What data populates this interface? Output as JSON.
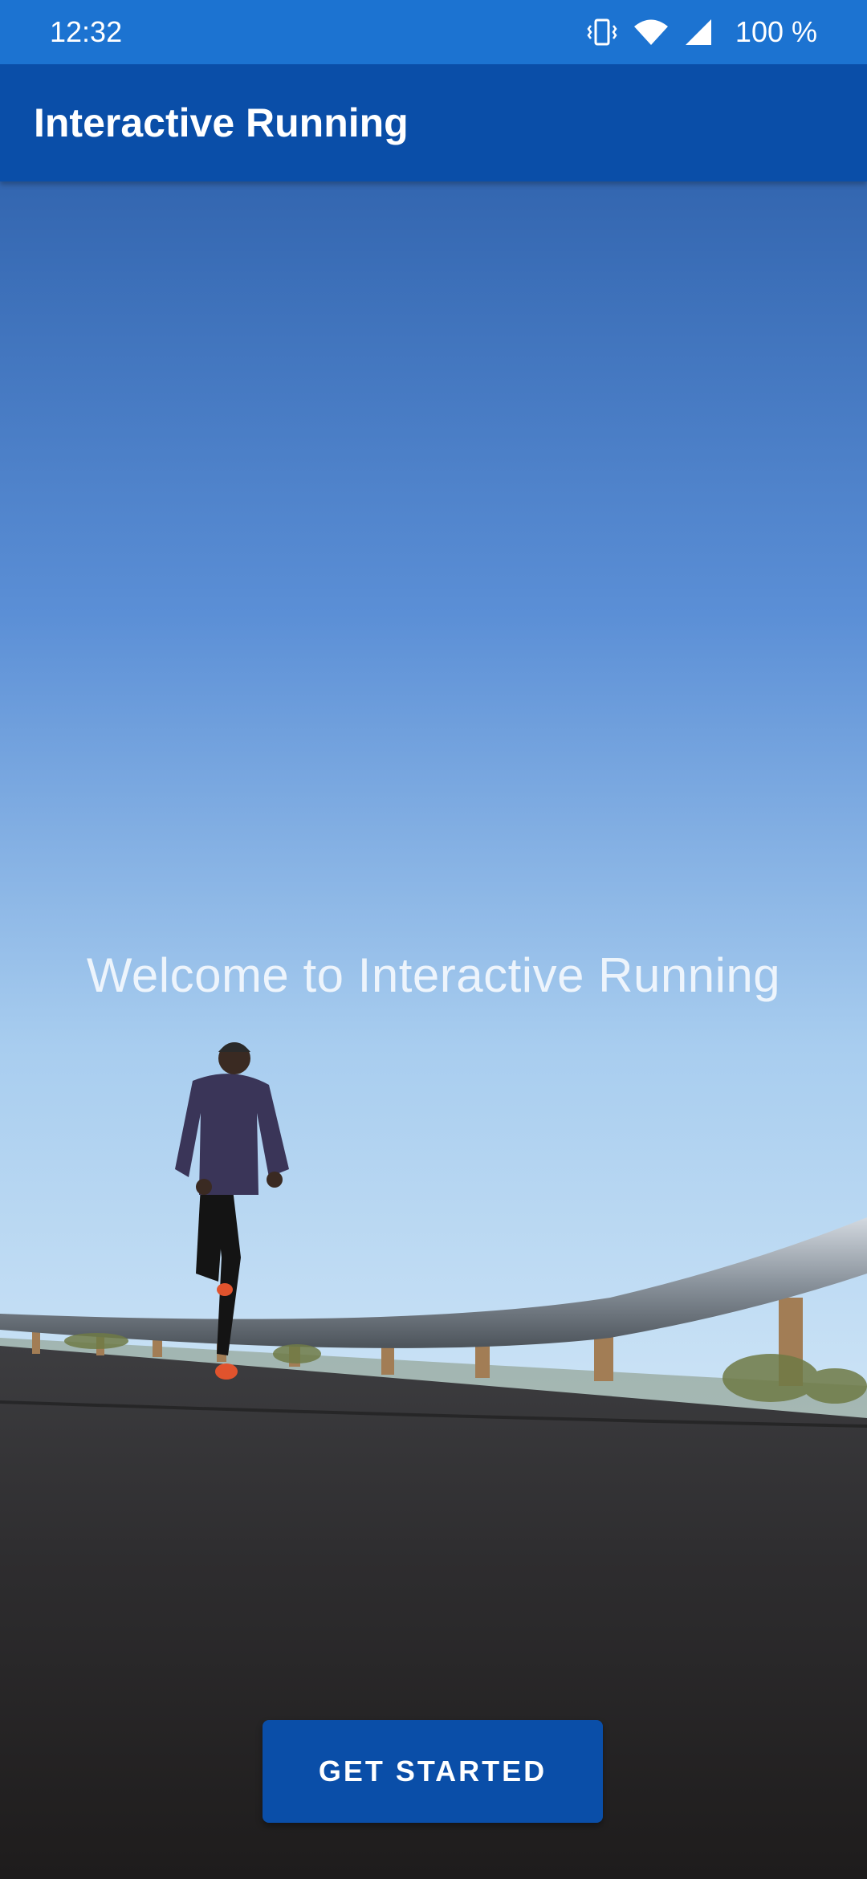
{
  "status_bar": {
    "time": "12:32",
    "battery": "100 %",
    "icons": [
      "vibrate-icon",
      "wifi-icon",
      "cellular-signal-icon"
    ]
  },
  "app_bar": {
    "title": "Interactive Running"
  },
  "hero": {
    "image": "runner-on-road-photo",
    "welcome_text": "Welcome to Interactive Running"
  },
  "actions": {
    "get_started_label": "GET STARTED"
  },
  "colors": {
    "status_bar": "#1c73d1",
    "app_bar": "#0a4ea8",
    "button": "#0a4ea8"
  }
}
